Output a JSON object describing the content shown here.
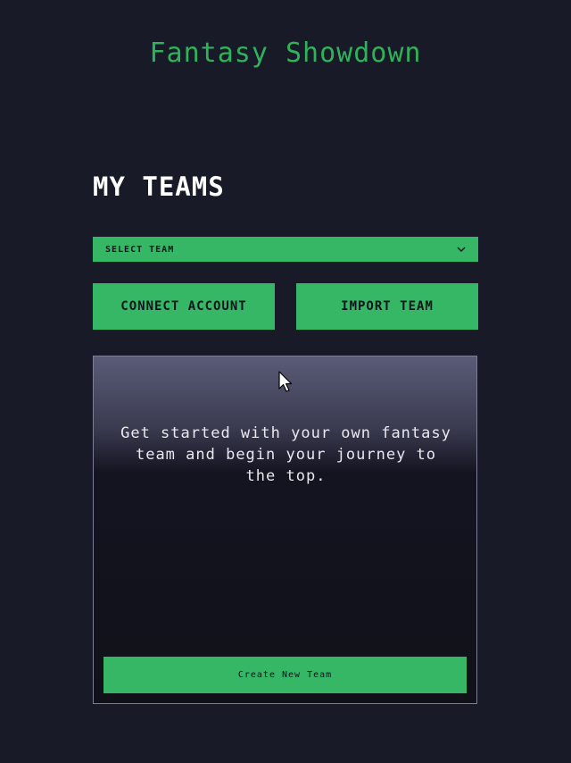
{
  "app": {
    "title": "Fantasy Showdown"
  },
  "teams": {
    "heading": "MY TEAMS",
    "select_label": "SELECT TEAM",
    "connect_label": "CONNECT ACCOUNT",
    "import_label": "IMPORT TEAM"
  },
  "empty_state": {
    "message": "Get started with your own fantasy team and begin your journey to the top.",
    "create_label": "Create New Team"
  },
  "colors": {
    "accent": "#35b765",
    "background": "#191a28",
    "title_green": "#2fb35a"
  },
  "icons": {
    "select_chevron": "chevron-down-icon",
    "pointer": "mouse-cursor-icon"
  }
}
